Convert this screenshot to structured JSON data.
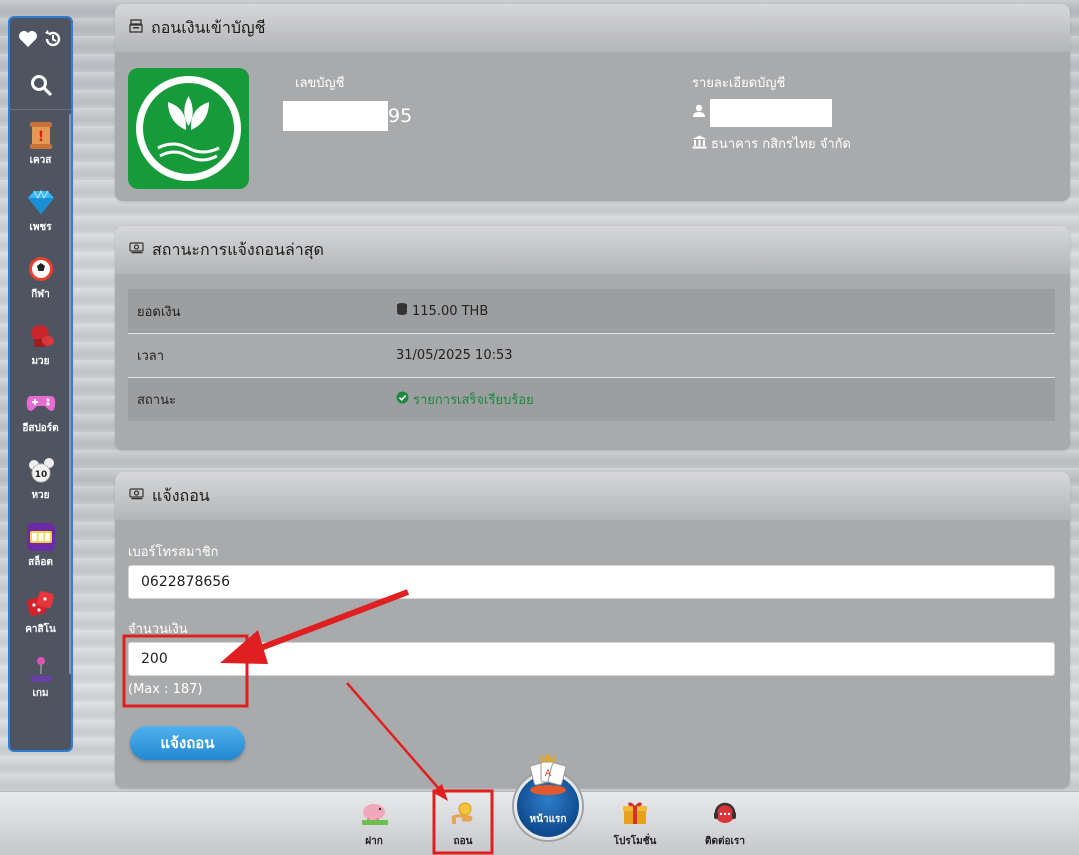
{
  "sidebar": {
    "items": [
      {
        "label": "เควส",
        "icon": "scroll-icon"
      },
      {
        "label": "เพชร",
        "icon": "diamond-icon"
      },
      {
        "label": "กีฬา",
        "icon": "soccer-ball-icon"
      },
      {
        "label": "มวย",
        "icon": "boxing-glove-icon"
      },
      {
        "label": "อีสปอร์ต",
        "icon": "gamepad-icon"
      },
      {
        "label": "หวย",
        "icon": "lottery-balls-icon"
      },
      {
        "label": "สล็อต",
        "icon": "slot-machine-icon"
      },
      {
        "label": "คาสิโน",
        "icon": "dice-icon"
      },
      {
        "label": "เกม",
        "icon": "joystick-icon"
      }
    ]
  },
  "account_card": {
    "title": "ถอนเงินเข้าบัญชี",
    "account_number_label": "เลขบัญชี",
    "account_number_suffix": "95",
    "details_label": "รายละเอียดบัญชี",
    "bank_name": "ธนาคาร กสิกรไทย จำกัด"
  },
  "status_card": {
    "title": "สถานะการแจ้งถอนล่าสุด",
    "rows": [
      {
        "key": "ยอดเงิน",
        "value": "115.00 THB"
      },
      {
        "key": "เวลา",
        "value": "31/05/2025 10:53"
      },
      {
        "key": "สถานะ",
        "value": "รายการเสร็จเรียบร้อย"
      }
    ]
  },
  "withdraw_card": {
    "title": "แจ้งถอน",
    "member_label": "เบอร์โทรสมาชิก",
    "member_value": "0622878656",
    "amount_label": "จำนวนเงิน",
    "amount_value": "200",
    "max_note": "(Max : 187)",
    "submit_label": "แจ้งถอน"
  },
  "bottom_nav": {
    "deposit": "ฝาก",
    "withdraw": "ถอน",
    "home": "หน้าแรก",
    "promotion": "โปรโมชั่น",
    "contact": "ติดต่อเรา"
  },
  "colors": {
    "accent_blue": "#2287cf",
    "success_green": "#198a3f",
    "annotation_red": "#e02020",
    "bank_green": "#179a3a"
  }
}
